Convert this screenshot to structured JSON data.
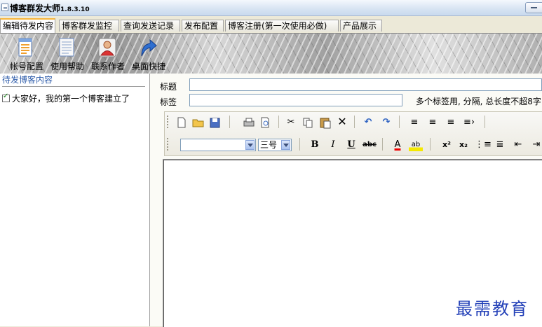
{
  "app": {
    "title": "博客群发大师",
    "version": "1.8.3.10"
  },
  "tabs": [
    {
      "label": "编辑待发内容",
      "active": true
    },
    {
      "label": "博客群发监控"
    },
    {
      "label": "查询发送记录"
    },
    {
      "label": "发布配置"
    },
    {
      "label": "博客注册(第一次使用必做)"
    },
    {
      "label": "产品展示"
    }
  ],
  "ribbon": {
    "tools": [
      {
        "label": "帐号配置",
        "icon": "account-config-icon"
      },
      {
        "label": "使用帮助",
        "icon": "help-document-icon"
      },
      {
        "label": "联系作者",
        "icon": "contact-person-icon"
      },
      {
        "label": "桌面快捷",
        "icon": "desktop-shortcut-arrow-icon"
      }
    ]
  },
  "left_panel": {
    "header": "待发博客内容",
    "posts": [
      {
        "title": "大家好，我的第一个博客建立了",
        "checked": true
      }
    ]
  },
  "form": {
    "title_label": "标题",
    "tags_label": "标签",
    "title_value": "",
    "tags_value": "",
    "tags_hint": "多个标签用, 分隔, 总长度不超8字"
  },
  "editor": {
    "font_name": "",
    "font_size": "三号",
    "buttons": {
      "bold": "B",
      "italic": "I",
      "underline": "U",
      "strike": "abc",
      "font_color": "A",
      "highlight": "ab",
      "superscript": "x²",
      "subscript": "x₂"
    }
  },
  "watermark": "最需教育",
  "colors": {
    "tab_accent": "#f7b53c",
    "panel_header": "#2e5caa",
    "watermark": "#2441b8"
  }
}
